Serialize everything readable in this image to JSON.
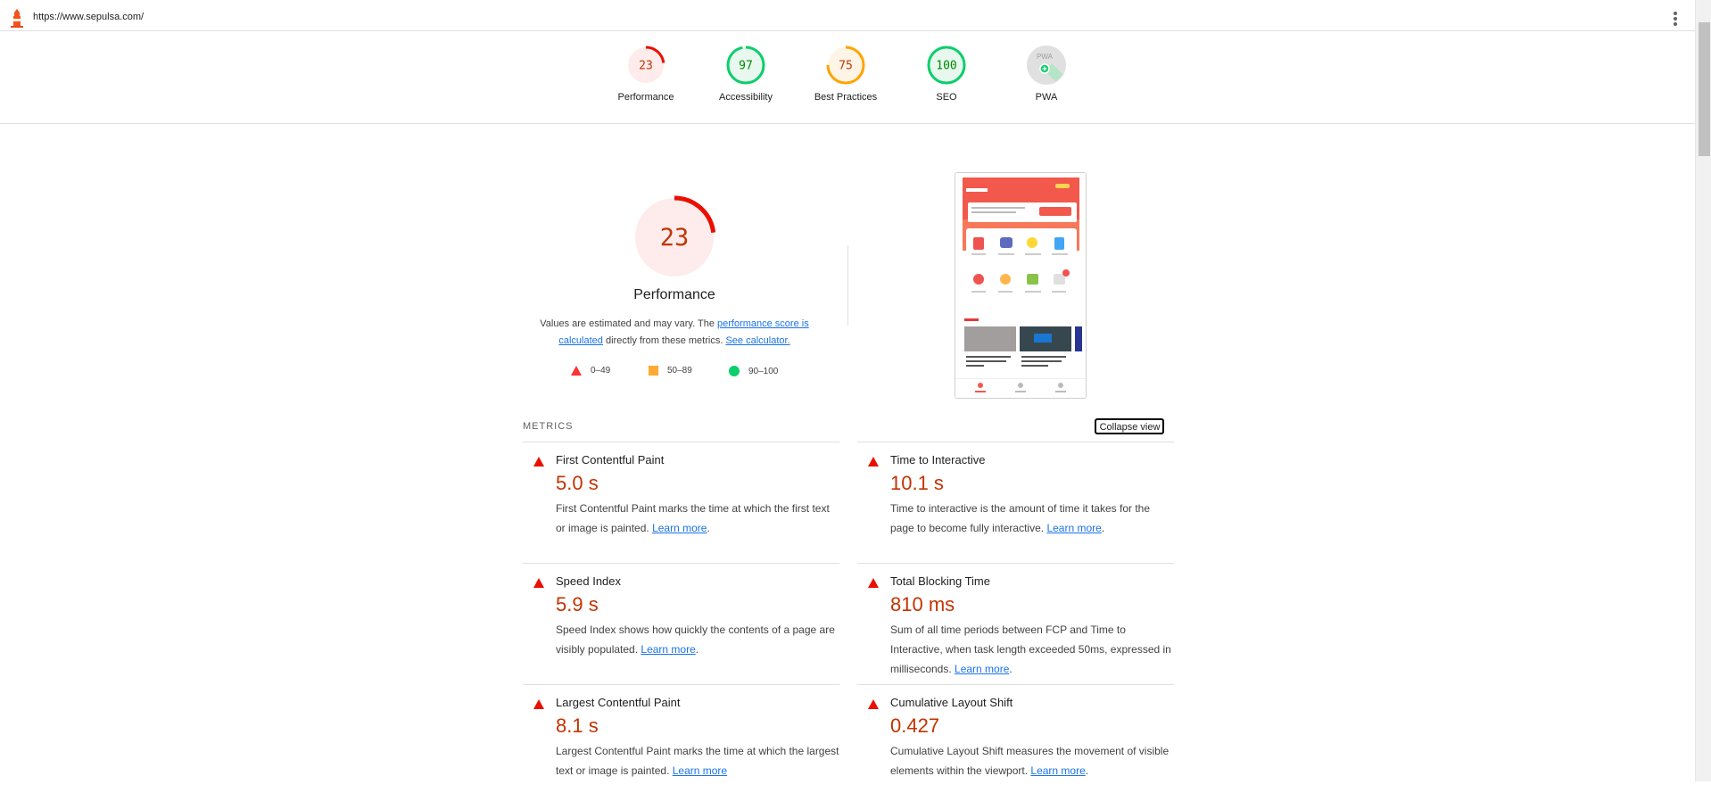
{
  "browser": {
    "url": "https://www.sepulsa.com/"
  },
  "summary": [
    {
      "score": "23",
      "label": "Performance",
      "status": "fail",
      "fraction": 0.23
    },
    {
      "score": "97",
      "label": "Accessibility",
      "status": "pass",
      "fraction": 0.97
    },
    {
      "score": "75",
      "label": "Best Practices",
      "status": "average",
      "fraction": 0.75
    },
    {
      "score": "100",
      "label": "SEO",
      "status": "pass",
      "fraction": 1.0
    },
    {
      "score": "",
      "label": "PWA",
      "status": "pwa",
      "badge": "PWA"
    }
  ],
  "performance": {
    "score": "23",
    "fraction": 0.23,
    "title": "Performance",
    "note_prefix": "Values are estimated and may vary. The ",
    "note_link": "performance score is calculated",
    "note_middle": " directly from these metrics. ",
    "note_calc": "See calculator.",
    "legend": [
      {
        "range": "0–49",
        "shape": "triangle",
        "color": "#ff3333"
      },
      {
        "range": "50–89",
        "shape": "square",
        "color": "#ffaa33"
      },
      {
        "range": "90–100",
        "shape": "circle",
        "color": "#0cce6b"
      }
    ]
  },
  "metrics": {
    "section_label": "METRICS",
    "collapse_label": "Collapse view",
    "items": [
      {
        "title": "First Contentful Paint",
        "value": "5.0 s",
        "desc": "First Contentful Paint marks the time at which the first text or image is painted. ",
        "link": "Learn more",
        "suffix": "."
      },
      {
        "title": "Time to Interactive",
        "value": "10.1 s",
        "desc": "Time to interactive is the amount of time it takes for the page to become fully interactive. ",
        "link": "Learn more",
        "suffix": "."
      },
      {
        "title": "Speed Index",
        "value": "5.9 s",
        "desc": "Speed Index shows how quickly the contents of a page are visibly populated. ",
        "link": "Learn more",
        "suffix": "."
      },
      {
        "title": "Total Blocking Time",
        "value": "810 ms",
        "desc": "Sum of all time periods between FCP and Time to Interactive, when task length exceeded 50ms, expressed in milliseconds. ",
        "link": "Learn more",
        "suffix": "."
      },
      {
        "title": "Largest Contentful Paint",
        "value": "8.1 s",
        "desc": "Largest Contentful Paint marks the time at which the largest text or image is painted. ",
        "link": "Learn more",
        "suffix": ""
      },
      {
        "title": "Cumulative Layout Shift",
        "value": "0.427",
        "desc": "Cumulative Layout Shift measures the movement of visible elements within the viewport. ",
        "link": "Learn more",
        "suffix": "."
      }
    ]
  },
  "colors": {
    "fail": "#eb0f00",
    "fail_bg": "#fdeceb",
    "fail_text": "#c33300",
    "pass": "#0cce6b",
    "pass_bg": "#e8f8ef",
    "pass_text": "#008800",
    "average": "#ffa400",
    "average_bg": "#fff5e6",
    "average_text": "#c33300",
    "link": "#1a73e8"
  }
}
